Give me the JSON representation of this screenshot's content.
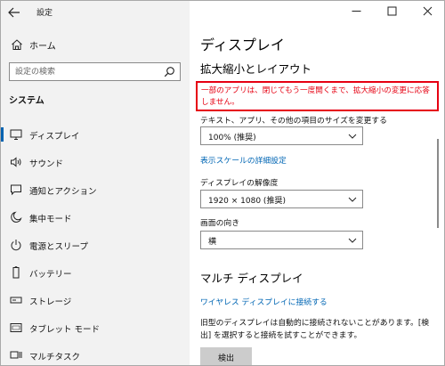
{
  "window": {
    "title": "設定",
    "controls": [
      "minimize-icon",
      "maximize-icon",
      "close-icon"
    ]
  },
  "sidebar": {
    "home_label": "ホーム",
    "search_placeholder": "設定の検索",
    "section_label": "システム",
    "items": [
      {
        "label": "ディスプレイ",
        "icon": "monitor-icon",
        "active": true
      },
      {
        "label": "サウンド",
        "icon": "speaker-icon",
        "active": false
      },
      {
        "label": "通知とアクション",
        "icon": "notification-icon",
        "active": false
      },
      {
        "label": "集中モード",
        "icon": "moon-icon",
        "active": false
      },
      {
        "label": "電源とスリープ",
        "icon": "power-icon",
        "active": false
      },
      {
        "label": "バッテリー",
        "icon": "battery-icon",
        "active": false
      },
      {
        "label": "ストレージ",
        "icon": "storage-icon",
        "active": false
      },
      {
        "label": "タブレット モード",
        "icon": "tablet-icon",
        "active": false
      },
      {
        "label": "マルチタスク",
        "icon": "multitask-icon",
        "active": false
      }
    ]
  },
  "main": {
    "page_title": "ディスプレイ",
    "subheading": "拡大縮小とレイアウト",
    "warning_text": "一部のアプリは、閉じてもう一度開くまで、拡大縮小の変更に応答しません。",
    "scale_label": "テキスト、アプリ、その他の項目のサイズを変更する",
    "scale_value": "100% (推奨)",
    "advanced_scaling_link": "表示スケールの詳細設定",
    "resolution_label": "ディスプレイの解像度",
    "resolution_value": "1920 × 1080 (推奨)",
    "orientation_label": "画面の向き",
    "orientation_value": "横",
    "multi_display_heading": "マルチ ディスプレイ",
    "wireless_link": "ワイヤレス ディスプレイに接続する",
    "description": "旧型のディスプレイは自動的に接続されないことがあります。[検出] を選択すると接続を試すことができます。",
    "detect_button": "検出"
  },
  "colors": {
    "accent": "#0063b1",
    "link": "#0066b4",
    "warning": "#e60012",
    "sidebar_bg": "#f2f2f2"
  }
}
